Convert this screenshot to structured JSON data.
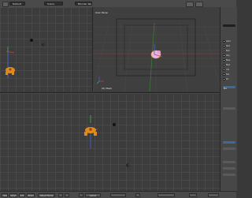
{
  "header": {
    "menu_icon": "info-icon",
    "screen_layout": "Default",
    "scene": "Scene",
    "render_engine": "Blender Render"
  },
  "views": {
    "top_right": {
      "title": "User Persp",
      "object_label": "(0) Mesh"
    }
  },
  "right_panel": {
    "items": [
      {
        "label": "Cam",
        "checked": false
      },
      {
        "label": "Shd",
        "checked": true
      },
      {
        "label": "Bck",
        "checked": false
      },
      {
        "label": "Obj",
        "checked": true
      },
      {
        "label": "Mes",
        "checked": true
      },
      {
        "label": "Msh",
        "checked": false
      },
      {
        "label": "Vrt",
        "checked": false
      },
      {
        "label": "Tex",
        "checked": false
      },
      {
        "label": "Pri",
        "checked": false
      }
    ],
    "active_tab": "Pro"
  },
  "footer": {
    "view_menu": "View",
    "select_menu": "Select",
    "add_menu": "Add",
    "object_menu": "Object",
    "mode": "Object Mode",
    "global": "Global"
  },
  "colors": {
    "background": "#393939",
    "object_orange": "#e08a1c",
    "selected_pink": "#e6b3e6",
    "axis_x": "#d63b3b",
    "axis_y": "#3bb84a",
    "axis_z": "#3b6be0"
  }
}
